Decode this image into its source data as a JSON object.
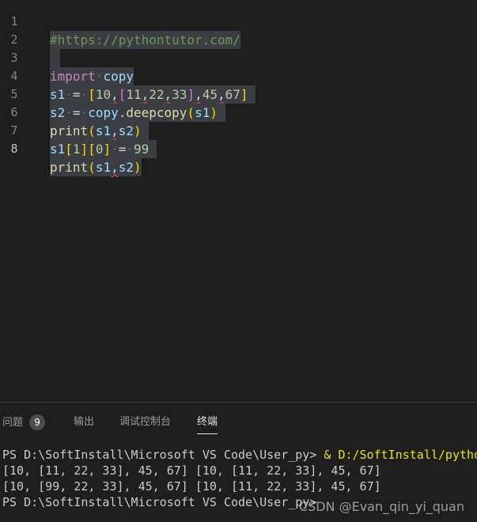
{
  "editor": {
    "line_numbers": [
      "1",
      "2",
      "3",
      "4",
      "5",
      "6",
      "7",
      "8"
    ],
    "lines": [
      "#https://pythontutor.com/",
      "",
      "import copy",
      "s1 = [10,[11,22,33],45,67]",
      "s2 = copy.deepcopy(s1)",
      "print(s1,s2)",
      "s1[1][0] = 99",
      "print(s1,s2)"
    ],
    "colors": {
      "background": "#1e1e1e",
      "selection": "#3a3d41",
      "comment": "#6a9955",
      "keyword": "#c586c0",
      "variable": "#9cdcfe",
      "function": "#dcdcaa",
      "number": "#b5cea8"
    }
  },
  "panel": {
    "tabs": [
      {
        "label": "问题",
        "badge": "9"
      },
      {
        "label": "输出"
      },
      {
        "label": "调试控制台"
      },
      {
        "label": "终端",
        "active": true
      }
    ],
    "terminal": {
      "prompt1": "PS D:\\SoftInstall\\Microsoft VS Code\\User_py> ",
      "command": "& D:/SoftInstall/pytho",
      "out1": "[10, [11, 22, 33], 45, 67] [10, [11, 22, 33], 45, 67]",
      "out2": "[10, [99, 22, 33], 45, 67] [10, [11, 22, 33], 45, 67]",
      "prompt2": "PS D:\\SoftInstall\\Microsoft VS Code\\User_py> "
    }
  },
  "watermark": "CSDN @Evan_qin_yi_quan"
}
